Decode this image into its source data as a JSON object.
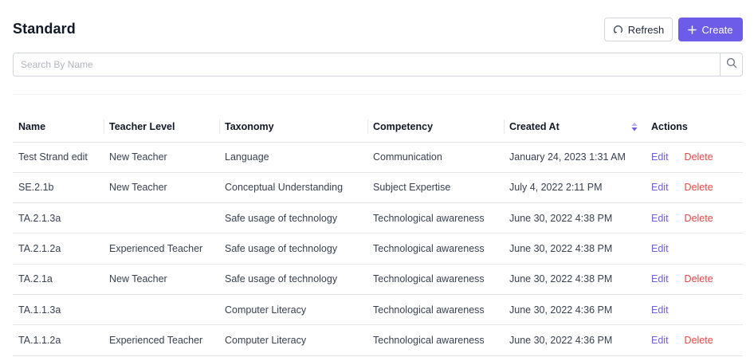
{
  "page": {
    "title": "Standard"
  },
  "toolbar": {
    "refresh_label": "Refresh",
    "create_label": "Create"
  },
  "search": {
    "placeholder": "Search By Name",
    "value": ""
  },
  "table": {
    "columns": [
      "Name",
      "Teacher Level",
      "Taxonomy",
      "Competency",
      "Created At",
      "Actions"
    ],
    "edit_label": "Edit",
    "delete_label": "Delete",
    "rows": [
      {
        "name": "Test Strand edit",
        "teacher_level": "New Teacher",
        "taxonomy": "Language",
        "competency": "Communication",
        "created_at": "January 24, 2023 1:31 AM",
        "has_delete": true
      },
      {
        "name": "SE.2.1b",
        "teacher_level": "New Teacher",
        "taxonomy": "Conceptual Understanding",
        "competency": "Subject Expertise",
        "created_at": "July 4, 2022 2:11 PM",
        "has_delete": true
      },
      {
        "name": "TA.2.1.3a",
        "teacher_level": "",
        "taxonomy": "Safe usage of technology",
        "competency": "Technological awareness",
        "created_at": "June 30, 2022 4:38 PM",
        "has_delete": true
      },
      {
        "name": "TA.2.1.2a",
        "teacher_level": "Experienced Teacher",
        "taxonomy": "Safe usage of technology",
        "competency": "Technological awareness",
        "created_at": "June 30, 2022 4:38 PM",
        "has_delete": false
      },
      {
        "name": "TA.2.1a",
        "teacher_level": "New Teacher",
        "taxonomy": "Safe usage of technology",
        "competency": "Technological awareness",
        "created_at": "June 30, 2022 4:38 PM",
        "has_delete": true
      },
      {
        "name": "TA.1.1.3a",
        "teacher_level": "",
        "taxonomy": "Computer Literacy",
        "competency": "Technological awareness",
        "created_at": "June 30, 2022 4:36 PM",
        "has_delete": false
      },
      {
        "name": "TA.1.1.2a",
        "teacher_level": "Experienced Teacher",
        "taxonomy": "Computer Literacy",
        "competency": "Technological awareness",
        "created_at": "June 30, 2022 4:36 PM",
        "has_delete": true
      }
    ]
  },
  "colors": {
    "accent": "#6c5ce7",
    "danger": "#ef4444",
    "border": "#e5e7eb"
  },
  "icons": {
    "refresh": "refresh-icon",
    "create": "plus-icon",
    "search": "search-icon",
    "sort": "sort-icon"
  }
}
